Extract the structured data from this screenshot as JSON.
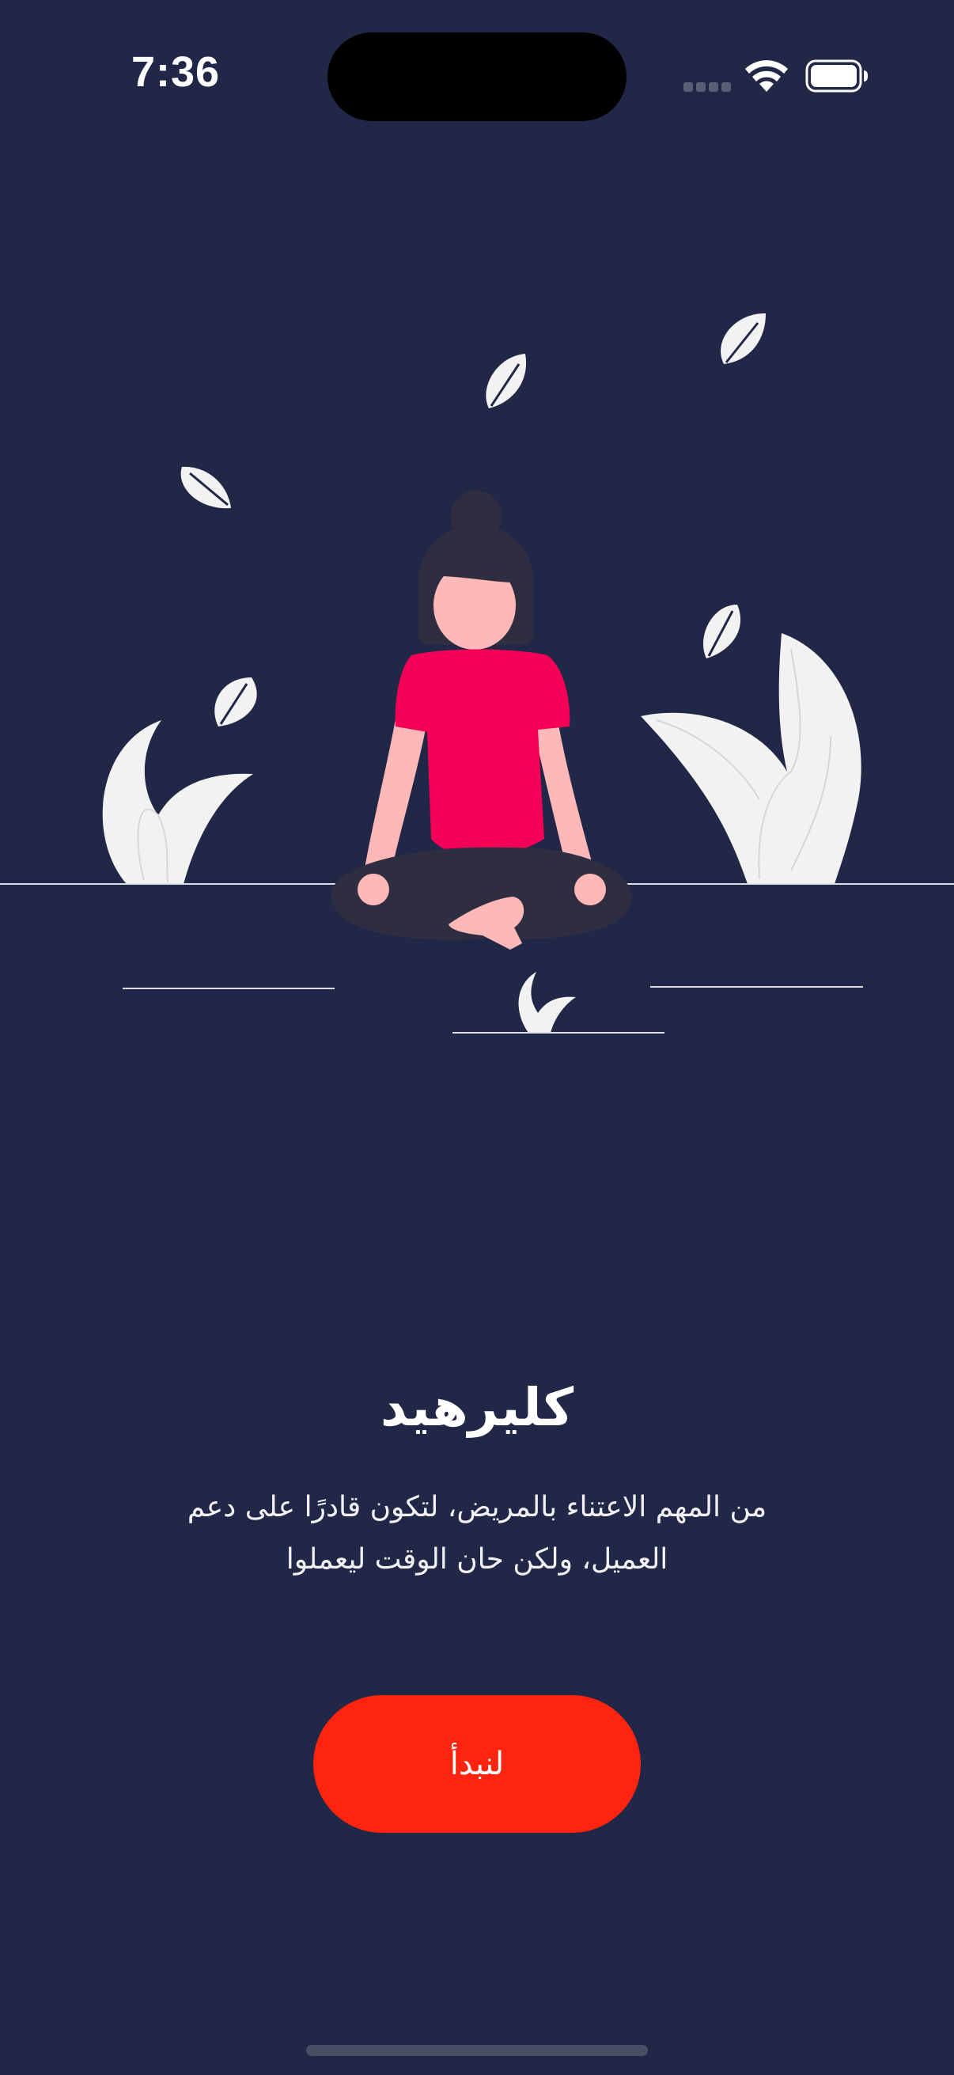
{
  "status_bar": {
    "time": "7:36"
  },
  "icons": {
    "signal": "cellular-signal-icon",
    "wifi": "wifi-icon",
    "battery": "battery-icon"
  },
  "illustration": {
    "subject": "meditation-illustration"
  },
  "onboarding": {
    "title": "كليرهيد",
    "description_line1": "من المهم الاعتناء بالمريض، لتكون قادرًا على دعم",
    "description_line2": "العميل، ولكن حان الوقت ليعملوا",
    "start_label": "لنبدأ"
  },
  "colors": {
    "background": "#212746",
    "button": "#ff240f",
    "shirt": "#f50057",
    "skin": "#ffb8b8",
    "hair": "#2f2e41",
    "leaf": "#f2f2f2"
  }
}
